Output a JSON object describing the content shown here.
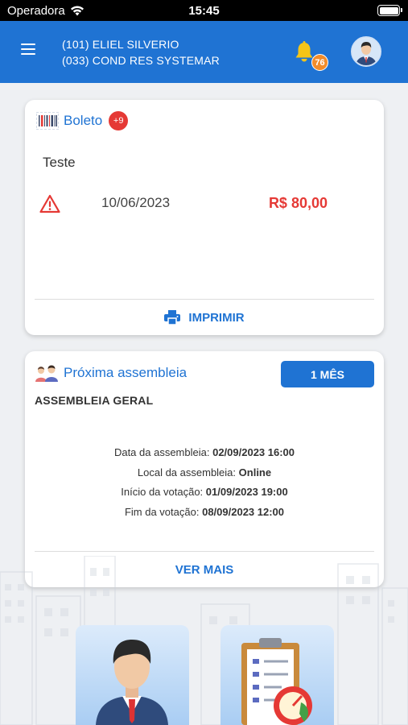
{
  "status_bar": {
    "carrier": "Operadora",
    "time": "15:45"
  },
  "header": {
    "unit_line": "(101) ELIEL SILVERIO",
    "condo_line": "(033) COND RES SYSTEMAR",
    "notification_count": "76",
    "accent_color": "#1f73d3"
  },
  "boleto_card": {
    "title": "Boleto",
    "badge": "+9",
    "description": "Teste",
    "due_date": "10/06/2023",
    "amount": "R$ 80,00",
    "action_label": "IMPRIMIR",
    "icon": "barcode-icon"
  },
  "assembly_card": {
    "title": "Próxima assembleia",
    "period_button": "1 MÊS",
    "name": "ASSEMBLEIA GERAL",
    "details": [
      {
        "label": "Data da assembleia:",
        "value": "02/09/2023 16:00"
      },
      {
        "label": "Local da assembleia:",
        "value": "Online"
      },
      {
        "label": "Início da votação:",
        "value": "01/09/2023 19:00"
      },
      {
        "label": "Fim da votação:",
        "value": "08/09/2023 12:00"
      }
    ],
    "action_label": "VER MAIS",
    "icon": "people-icon"
  },
  "shortcuts": [
    {
      "icon": "businessman-icon"
    },
    {
      "icon": "checklist-clock-icon"
    }
  ]
}
